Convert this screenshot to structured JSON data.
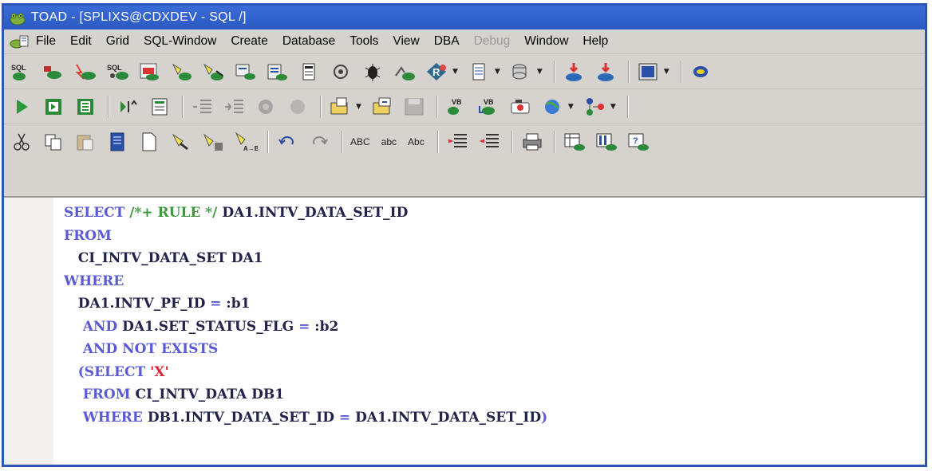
{
  "window": {
    "title": "TOAD - [SPLIXS@CDXDEV - SQL /]"
  },
  "menu": {
    "items": [
      "File",
      "Edit",
      "Grid",
      "SQL-Window",
      "Create",
      "Database",
      "Tools",
      "View",
      "DBA",
      "Debug",
      "Window",
      "Help"
    ],
    "disabled": [
      "Debug"
    ]
  },
  "toolbar3": {
    "case_upper": "ABC",
    "case_lower": "abc",
    "case_title": "Abc"
  },
  "editor": {
    "lines": [
      {
        "indent": "",
        "parts": [
          {
            "c": "kw",
            "t": "SELECT "
          },
          {
            "c": "cm",
            "t": "/*+ RULE */ "
          },
          {
            "c": "",
            "t": "DA1.INTV_DATA_SET_ID"
          }
        ]
      },
      {
        "indent": "",
        "parts": [
          {
            "c": "kw",
            "t": "FROM"
          }
        ]
      },
      {
        "indent": "   ",
        "parts": [
          {
            "c": "",
            "t": "CI_INTV_DATA_SET DA1"
          }
        ]
      },
      {
        "indent": "",
        "parts": [
          {
            "c": "kw",
            "t": "WHERE"
          }
        ]
      },
      {
        "indent": "   ",
        "parts": [
          {
            "c": "",
            "t": "DA1.INTV_PF_ID "
          },
          {
            "c": "op",
            "t": "= "
          },
          {
            "c": "",
            "t": ":b1"
          }
        ]
      },
      {
        "indent": "    ",
        "parts": [
          {
            "c": "kw",
            "t": "AND "
          },
          {
            "c": "",
            "t": "DA1.SET_STATUS_FLG "
          },
          {
            "c": "op",
            "t": "= "
          },
          {
            "c": "",
            "t": ":b2"
          }
        ]
      },
      {
        "indent": "    ",
        "parts": [
          {
            "c": "kw",
            "t": "AND NOT EXISTS"
          }
        ]
      },
      {
        "indent": "   ",
        "parts": [
          {
            "c": "kw",
            "t": "(SELECT "
          },
          {
            "c": "st",
            "t": "'X'"
          }
        ]
      },
      {
        "indent": "    ",
        "parts": [
          {
            "c": "kw",
            "t": "FROM "
          },
          {
            "c": "",
            "t": "CI_INTV_DATA DB1"
          }
        ]
      },
      {
        "indent": "    ",
        "parts": [
          {
            "c": "kw",
            "t": "WHERE "
          },
          {
            "c": "",
            "t": "DB1.INTV_DATA_SET_ID "
          },
          {
            "c": "op",
            "t": "= "
          },
          {
            "c": "",
            "t": "DA1.INTV_DATA_SET_ID"
          },
          {
            "c": "kw",
            "t": ")"
          }
        ]
      }
    ]
  },
  "colors": {
    "titlebar": "#2b59c3",
    "keyword": "#5a5ad6",
    "comment": "#3c9a3c",
    "string": "#d8273a"
  }
}
